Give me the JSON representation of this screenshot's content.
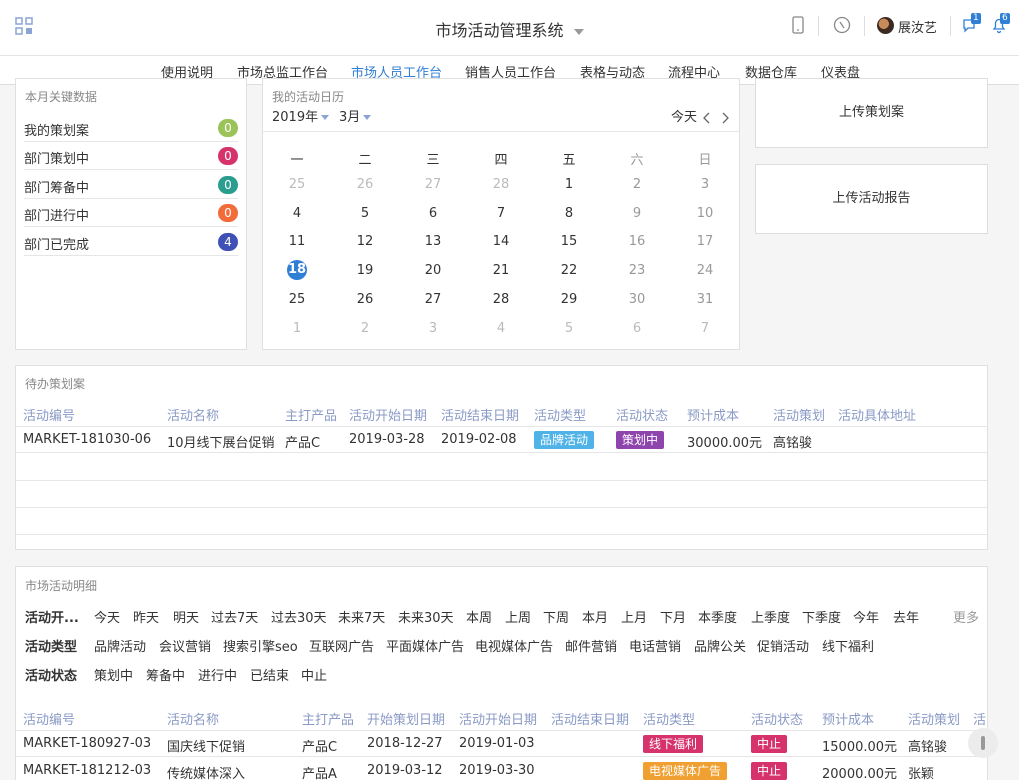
{
  "header": {
    "app_title": "市场活动管理系统",
    "user_name": "展汝艺",
    "msg_badge": "1",
    "bell_badge": "6"
  },
  "nav": {
    "items": [
      "使用说明",
      "市场总监工作台",
      "市场人员工作台",
      "销售人员工作台",
      "表格与动态",
      "流程中心",
      "数据仓库",
      "仪表盘"
    ],
    "active": "市场人员工作台"
  },
  "kpi": {
    "title": "本月关键数据",
    "items": [
      {
        "label": "我的策划案",
        "value": "0",
        "color": "#9bc35a"
      },
      {
        "label": "部门策划中",
        "value": "0",
        "color": "#d6336c"
      },
      {
        "label": "部门筹备中",
        "value": "0",
        "color": "#2a9d8f"
      },
      {
        "label": "部门进行中",
        "value": "0",
        "color": "#f26b3a"
      },
      {
        "label": "部门已完成",
        "value": "4",
        "color": "#3f51b5"
      }
    ]
  },
  "calendar": {
    "title": "我的活动日历",
    "year": "2019年",
    "month": "3月",
    "today_label": "今天",
    "weekdays": [
      "一",
      "二",
      "三",
      "四",
      "五",
      "六",
      "日"
    ],
    "weeks": [
      [
        "25",
        "26",
        "27",
        "28",
        "1",
        "2",
        "3"
      ],
      [
        "4",
        "5",
        "6",
        "7",
        "8",
        "9",
        "10"
      ],
      [
        "11",
        "12",
        "13",
        "14",
        "15",
        "16",
        "17"
      ],
      [
        "18",
        "19",
        "20",
        "21",
        "22",
        "23",
        "24"
      ],
      [
        "25",
        "26",
        "27",
        "28",
        "29",
        "30",
        "31"
      ],
      [
        "1",
        "2",
        "3",
        "4",
        "5",
        "6",
        "7"
      ]
    ],
    "today": "18"
  },
  "actions": {
    "upload_plan": "上传策划案",
    "upload_report": "上传活动报告"
  },
  "pending": {
    "title": "待办策划案",
    "headers": [
      "活动编号",
      "活动名称",
      "主打产品",
      "活动开始日期",
      "活动结束日期",
      "活动类型",
      "活动状态",
      "预计成本",
      "活动策划",
      "活动具体地址"
    ],
    "rows": [
      {
        "id": "MARKET-181030-06",
        "name": "10月线下展台促销",
        "product": "产品C",
        "start": "2019-03-28",
        "end": "2019-02-08",
        "type": "品牌活动",
        "type_color": "#4fb3e8",
        "status": "策划中",
        "status_color": "#8e44ad",
        "cost": "30000.00元",
        "planner": "高铭骏",
        "address": ""
      }
    ]
  },
  "details": {
    "title": "市场活动明细",
    "filters": [
      {
        "label": "活动开...",
        "items": [
          "今天",
          "昨天",
          "明天",
          "过去7天",
          "过去30天",
          "未来7天",
          "未来30天",
          "本周",
          "上周",
          "下周",
          "本月",
          "上月",
          "下月",
          "本季度",
          "上季度",
          "下季度",
          "今年",
          "去年"
        ]
      },
      {
        "label": "活动类型",
        "items": [
          "品牌活动",
          "会议营销",
          "搜索引擎seo",
          "互联网广告",
          "平面媒体广告",
          "电视媒体广告",
          "邮件营销",
          "电话营销",
          "品牌公关",
          "促销活动",
          "线下福利"
        ]
      },
      {
        "label": "活动状态",
        "items": [
          "策划中",
          "筹备中",
          "进行中",
          "已结束",
          "中止"
        ]
      }
    ],
    "more_label": "更多",
    "headers": [
      "活动编号",
      "活动名称",
      "主打产品",
      "开始策划日期",
      "活动开始日期",
      "活动结束日期",
      "活动类型",
      "活动状态",
      "预计成本",
      "活动策划",
      "活"
    ],
    "rows": [
      {
        "id": "MARKET-180927-03",
        "name": "国庆线下促销",
        "product": "产品C",
        "plan_date": "2018-12-27",
        "start": "2019-01-03",
        "end": "",
        "type": "线下福利",
        "type_color": "#d6336c",
        "status": "中止",
        "status_color": "#d6336c",
        "cost": "15000.00元",
        "planner": "高铭骏"
      },
      {
        "id": "MARKET-181212-03",
        "name": "传统媒体深入",
        "product": "产品A",
        "plan_date": "2019-03-12",
        "start": "2019-03-30",
        "end": "",
        "type": "电视媒体广告",
        "type_color": "#f0a030",
        "status": "中止",
        "status_color": "#d6336c",
        "cost": "20000.00元",
        "planner": "张颖"
      }
    ]
  }
}
